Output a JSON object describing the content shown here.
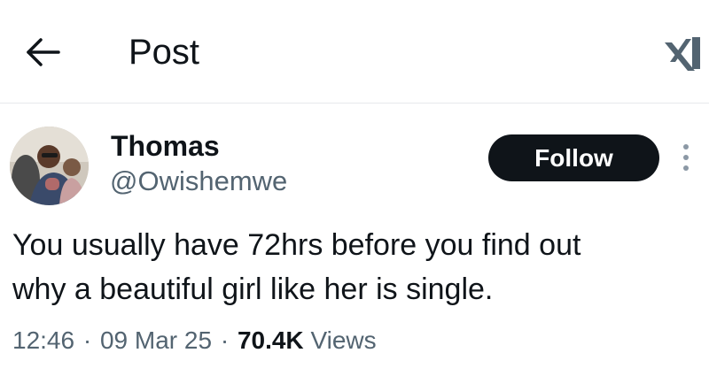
{
  "header": {
    "back_icon": "arrow-left-icon",
    "title": "Post",
    "logo_icon": "x-logo-icon"
  },
  "author": {
    "display_name": "Thomas",
    "handle": "@Owishemwe",
    "avatar_icon": "profile-photo"
  },
  "actions": {
    "follow_label": "Follow",
    "more_icon": "more-vertical-icon"
  },
  "post": {
    "text": "You usually have 72hrs before you find out\nwhy a beautiful girl like her is single.",
    "time": "12:46",
    "separator": "·",
    "date": "09 Mar 25",
    "views_count": "70.4K",
    "views_label": "Views"
  },
  "colors": {
    "text_primary": "#0f1419",
    "text_secondary": "#536471",
    "follow_button_bg": "#0f1419",
    "divider": "#e6e9ec"
  }
}
